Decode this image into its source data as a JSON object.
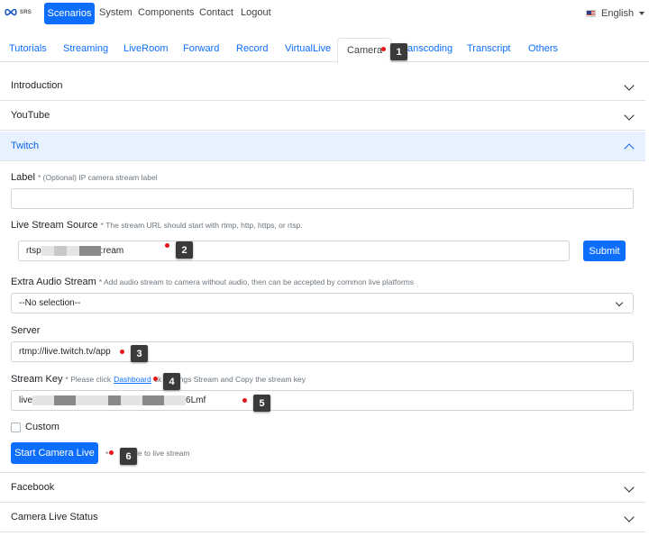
{
  "navbar": {
    "logo_text": "SRS",
    "active_item": "Scenarios",
    "items": [
      "System",
      "Components",
      "Contact",
      "Logout"
    ],
    "language": "English"
  },
  "tabs": {
    "items": [
      "Tutorials",
      "Streaming",
      "LiveRoom",
      "Forward",
      "Record",
      "VirtualLive"
    ],
    "active": "Camera",
    "after": [
      "Transcoding",
      "Transcript",
      "Others"
    ],
    "covered_transcoding": "anscoding"
  },
  "accordion": {
    "introduction": "Introduction",
    "youtube": "YouTube",
    "twitch": "Twitch",
    "facebook": "Facebook",
    "camera_status": "Camera Live Status"
  },
  "form": {
    "label_title": "Label",
    "label_hint": "* (Optional) IP camera stream label",
    "label_value": "",
    "source_title": "Live Stream Source",
    "source_hint": "* The stream URL should start with rtmp, http, https, or rtsp.",
    "source_value_start": "rtsp",
    "source_value_end": ":ream",
    "submit": "Submit",
    "audio_title": "Extra Audio Stream",
    "audio_hint": "* Add audio stream to camera without audio, then can be accepted by common live platforms",
    "audio_selected": "--No selection--",
    "server_title": "Server",
    "server_value": "rtmp://live.twitch.tv/app",
    "key_title": "Stream Key",
    "key_hint_pre": "* Please click",
    "key_hint_link": "Dashboard",
    "key_hint_post": "ck Settings Stream and Copy the stream key",
    "key_value_start": "live",
    "key_value_end": "6Lmf",
    "custom_label": "Custom",
    "start_button": "Start Camera Live",
    "start_hint": "t file to live stream",
    "start_hint_prefix": "*"
  },
  "markers": [
    "1",
    "2",
    "3",
    "4",
    "5",
    "6"
  ],
  "colors": {
    "primary": "#0d6efd",
    "marker_bg": "#3a3a3a",
    "marker_dot": "#e8141b",
    "accordion_open_bg": "#e7f1ff"
  }
}
